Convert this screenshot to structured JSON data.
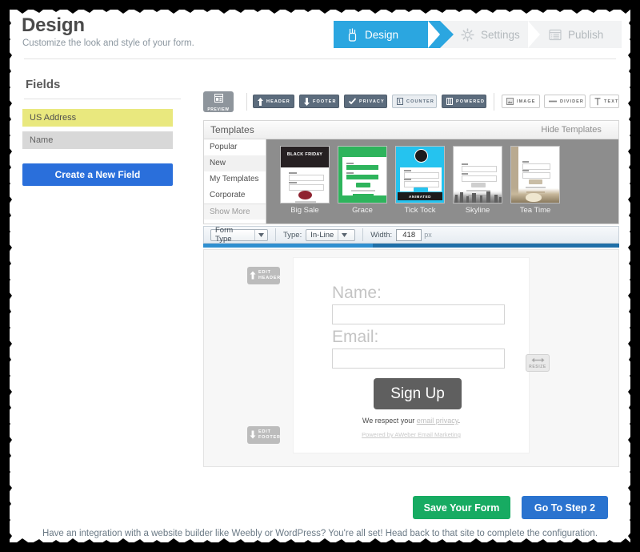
{
  "header": {
    "title": "Design",
    "subtitle": "Customize the look and style of your form.",
    "steps": [
      {
        "label": "Design",
        "icon": "paint-brush-icon",
        "active": true
      },
      {
        "label": "Settings",
        "icon": "gear-icon",
        "active": false
      },
      {
        "label": "Publish",
        "icon": "window-list-icon",
        "active": false
      }
    ]
  },
  "sidebar": {
    "title": "Fields",
    "fields": [
      {
        "label": "US Address",
        "state": "selected"
      },
      {
        "label": "Name",
        "state": "default"
      }
    ],
    "create_button": "Create a New Field"
  },
  "toolbar": {
    "preview_label": "PREVIEW",
    "buttons": [
      {
        "label": "HEADER",
        "icon": "arrow-up-icon",
        "style": "dark"
      },
      {
        "label": "FOOTER",
        "icon": "arrow-down-icon",
        "style": "dark"
      },
      {
        "label": "PRIVACY",
        "icon": "check-icon",
        "style": "dark"
      },
      {
        "label": "COUNTER",
        "icon": "counter-icon",
        "style": "light"
      },
      {
        "label": "POWERED",
        "icon": "columns-icon",
        "style": "dark"
      },
      {
        "label": "IMAGE",
        "icon": "image-icon",
        "style": "plain"
      },
      {
        "label": "DIVIDER",
        "icon": "divider-icon",
        "style": "plain"
      },
      {
        "label": "TEXT",
        "icon": "text-t-icon",
        "style": "plain"
      }
    ]
  },
  "templates": {
    "panel_title": "Templates",
    "hide_label": "Hide Templates",
    "categories": [
      {
        "label": "Popular",
        "selected": false
      },
      {
        "label": "New",
        "selected": true
      },
      {
        "label": "My Templates",
        "selected": false
      },
      {
        "label": "Corporate",
        "selected": false
      }
    ],
    "show_more": "Show More",
    "items": [
      {
        "name": "Big Sale",
        "banner_text": "BLACK FRIDAY",
        "accent": "#8f2330"
      },
      {
        "name": "Grace",
        "banner_text": "",
        "accent": "#2eb45c"
      },
      {
        "name": "Tick Tock",
        "banner_text": "ANIMATED",
        "accent": "#25c3ef"
      },
      {
        "name": "Skyline",
        "banner_text": "",
        "accent": "#bdbdbd"
      },
      {
        "name": "Tea Time",
        "banner_text": "",
        "accent": "#b9aa90"
      }
    ]
  },
  "form_bar": {
    "form_type_label": "Form Type",
    "type_label": "Type:",
    "type_value": "In-Line",
    "width_label": "Width:",
    "width_value": "418",
    "width_unit": "px"
  },
  "preview": {
    "edit_header_line1": "EDIT",
    "edit_header_line2": "HEADER",
    "edit_footer_line1": "EDIT",
    "edit_footer_line2": "FOOTER",
    "resize_label": "RESIZE",
    "name_label": "Name:",
    "email_label": "Email:",
    "signup_button": "Sign Up",
    "respect_prefix": "We respect your ",
    "respect_link": "email privacy",
    "respect_suffix": ".",
    "powered_by": "Powered by AWeber Email Marketing"
  },
  "footer": {
    "save_button": "Save Your Form",
    "next_button": "Go To Step 2",
    "note": "Have an integration with a website builder like Weebly or WordPress? You're all set! Head back to that site to complete the configuration."
  },
  "colors": {
    "accent_blue": "#2ba6e0",
    "primary_blue": "#2a6fdb",
    "save_green": "#17ab62",
    "field_selected": "#e9e87e"
  }
}
